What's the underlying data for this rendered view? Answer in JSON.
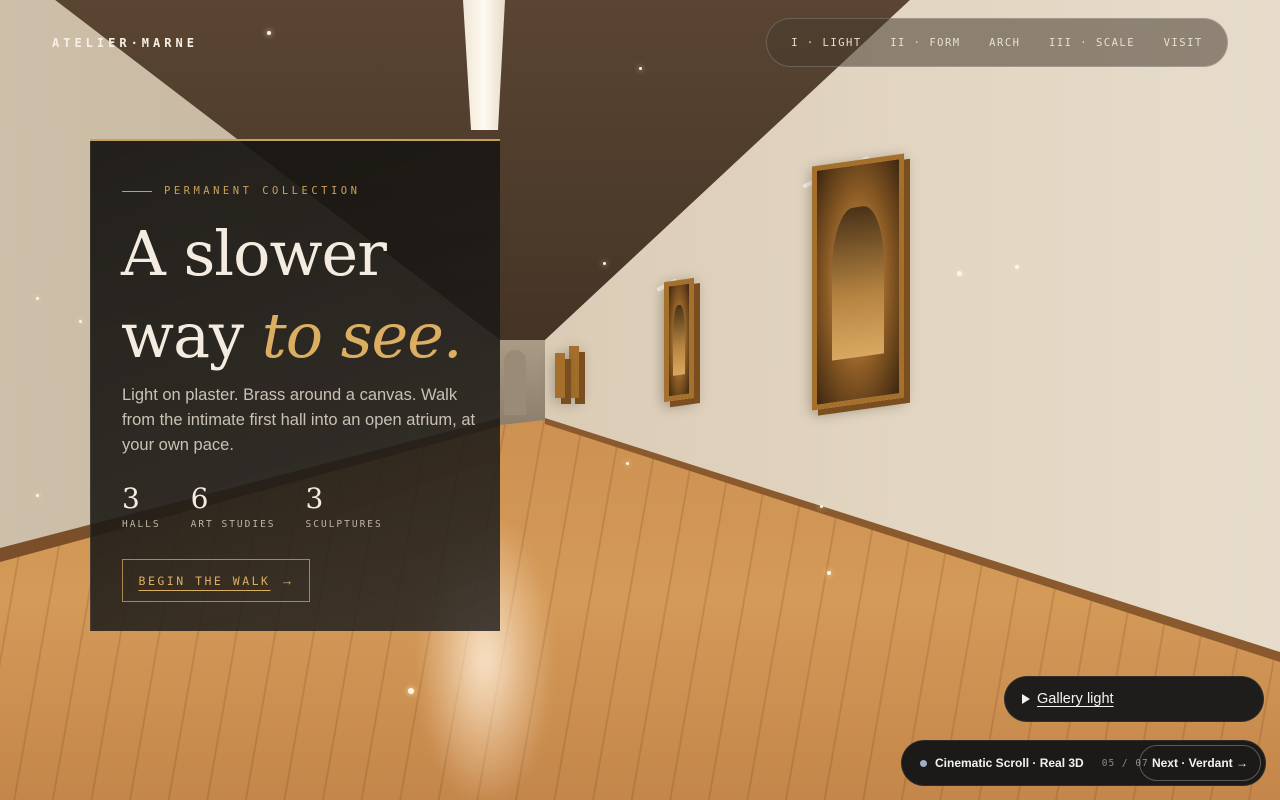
{
  "brand": "ATELIER·MARNE",
  "nav": [
    {
      "label": "I · LIGHT"
    },
    {
      "label": "II · FORM"
    },
    {
      "label": "ARCH"
    },
    {
      "label": "III · SCALE"
    },
    {
      "label": "VISIT"
    }
  ],
  "hero": {
    "kicker": "PERMANENT COLLECTION",
    "headline_line1": "A slower",
    "headline_line2_plain": "way ",
    "headline_line2_accent": "to see.",
    "lede": "Light on plaster. Brass around a canvas. Walk from the intimate first hall into an open atrium, at your own pace.",
    "stats": [
      {
        "value": "3",
        "label": "HALLS"
      },
      {
        "value": "6",
        "label": "ART STUDIES"
      },
      {
        "value": "3",
        "label": "SCULPTURES"
      }
    ],
    "cta_label": "BEGIN THE WALK",
    "cta_arrow": "→"
  },
  "gallery_light": {
    "label": "Gallery light"
  },
  "demo_bar": {
    "title": "Cinematic Scroll · Real 3D",
    "count": "05 / 07",
    "next_label": "Next · Verdant →"
  },
  "colors": {
    "accent_gold": "#dcae62",
    "card_bg": "#161411",
    "text_light": "#f4ece0"
  }
}
